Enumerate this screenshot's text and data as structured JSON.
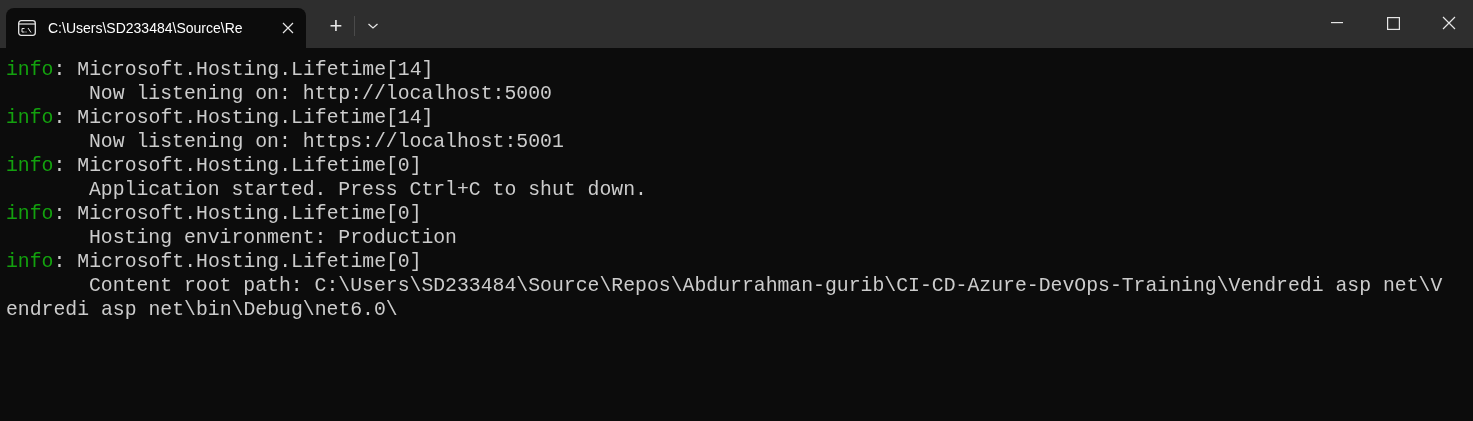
{
  "tabs": [
    {
      "title": "C:\\Users\\SD233484\\Source\\Re",
      "selected": true
    }
  ],
  "new_tab_button": "+",
  "log": [
    {
      "level": "info",
      "separator": ":",
      "source": "Microsoft.Hosting.Lifetime[14]",
      "lines": [
        {
          "kind": "indented",
          "text": "Now listening on: http://localhost:5000"
        }
      ]
    },
    {
      "level": "info",
      "separator": ":",
      "source": "Microsoft.Hosting.Lifetime[14]",
      "lines": [
        {
          "kind": "indented",
          "text": "Now listening on: https://localhost:5001"
        }
      ]
    },
    {
      "level": "info",
      "separator": ":",
      "source": "Microsoft.Hosting.Lifetime[0]",
      "lines": [
        {
          "kind": "indented",
          "text": "Application started. Press Ctrl+C to shut down."
        }
      ]
    },
    {
      "level": "info",
      "separator": ":",
      "source": "Microsoft.Hosting.Lifetime[0]",
      "lines": [
        {
          "kind": "indented",
          "text": "Hosting environment: Production"
        }
      ]
    },
    {
      "level": "info",
      "separator": ":",
      "source": "Microsoft.Hosting.Lifetime[0]",
      "lines": [
        {
          "kind": "indented",
          "text": "Content root path: C:\\Users\\SD233484\\Source\\Repos\\Abdurrahman-gurib\\CI-CD-Azure-DevOps-Training\\Vendredi asp net\\V"
        },
        {
          "kind": "wrapped",
          "text": "endredi asp net\\bin\\Debug\\net6.0\\"
        }
      ]
    }
  ]
}
